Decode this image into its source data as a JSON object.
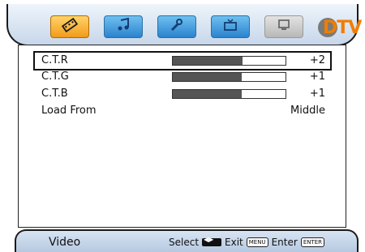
{
  "header": {
    "tabs": [
      {
        "name": "video",
        "icon": "film-icon",
        "active": true
      },
      {
        "name": "audio",
        "icon": "music-note-icon",
        "active": false
      },
      {
        "name": "setup",
        "icon": "wrench-icon",
        "active": false
      },
      {
        "name": "tv",
        "icon": "tv-icon",
        "active": false
      },
      {
        "name": "pc",
        "icon": "monitor-icon",
        "active": false,
        "disabled": true
      }
    ],
    "logo_text": "DTV"
  },
  "menu": {
    "items": [
      {
        "label": "C.T.R",
        "value": "+2",
        "level": 0.62,
        "selected": true
      },
      {
        "label": "C.T.G",
        "value": "+1",
        "level": 0.61
      },
      {
        "label": "C.T.B",
        "value": "+1",
        "level": 0.61
      },
      {
        "label": "Load From",
        "value": "Middle"
      }
    ]
  },
  "footer": {
    "title": "Video",
    "select_label": "Select",
    "exit_label": "Exit",
    "exit_key": "MENU",
    "enter_label": "Enter",
    "enter_key": "ENTER"
  }
}
